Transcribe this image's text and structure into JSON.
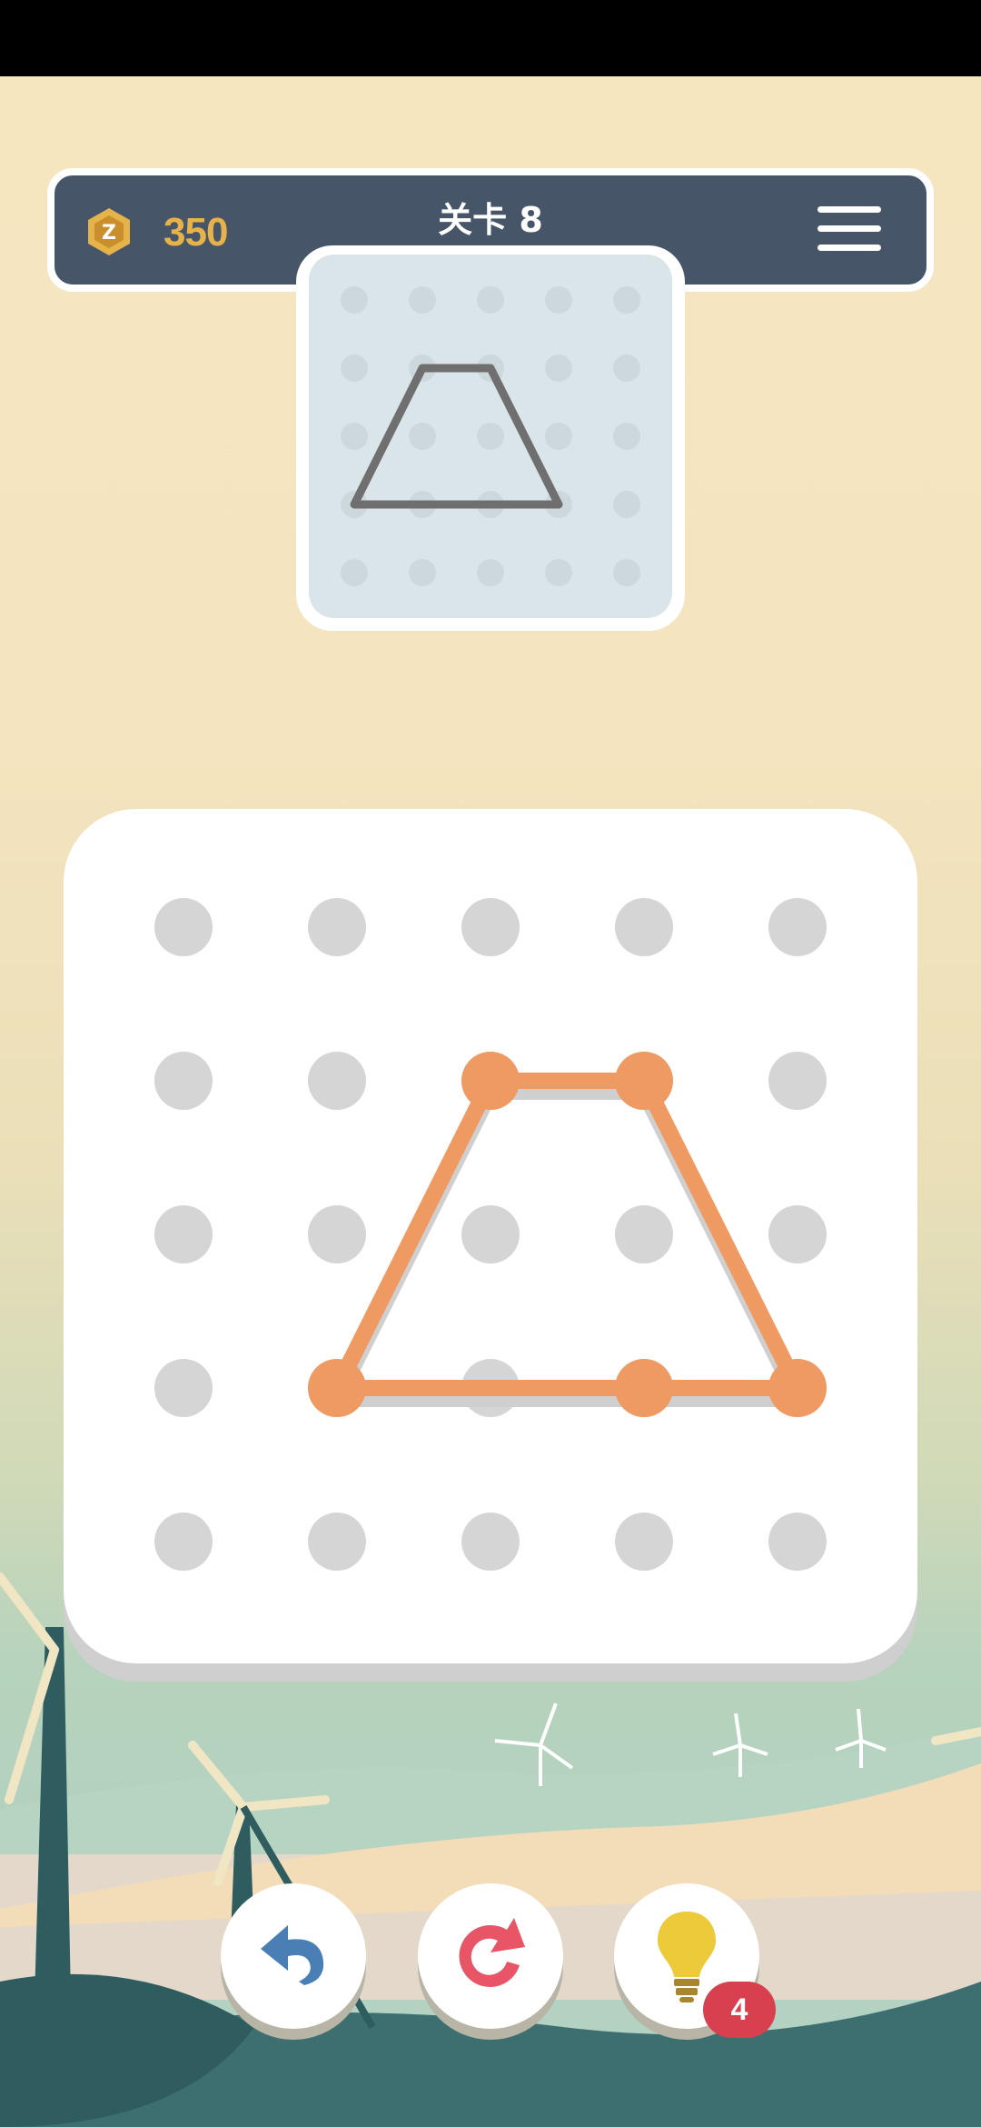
{
  "header": {
    "coins": "350",
    "level_title": "关卡 8",
    "coin_icon": "coin-icon",
    "menu_icon": "hamburger-menu-icon"
  },
  "target_preview": {
    "grid_cols": 5,
    "grid_rows": 5,
    "shape_color": "#6f6f6f",
    "shape_points": [
      [
        1,
        1
      ],
      [
        2,
        1
      ],
      [
        3,
        3
      ],
      [
        2,
        3
      ],
      [
        0,
        3
      ]
    ]
  },
  "board": {
    "grid_cols": 5,
    "grid_rows": 5,
    "peg_color": "#d5d5d5",
    "line_color": "#ef9a62",
    "path_points": [
      [
        2,
        1
      ],
      [
        3,
        1
      ],
      [
        4,
        3
      ],
      [
        3,
        3
      ],
      [
        1,
        3
      ]
    ],
    "closing_point": [
      2,
      1
    ]
  },
  "controls": {
    "undo_icon": "undo-arrow-icon",
    "restart_icon": "restart-icon",
    "hint_icon": "lightbulb-icon",
    "hint_count": "4"
  },
  "colors": {
    "accent": "#ef9a62",
    "header_bg": "#475568",
    "coin": "#e6b24a",
    "badge": "#d8404f"
  }
}
